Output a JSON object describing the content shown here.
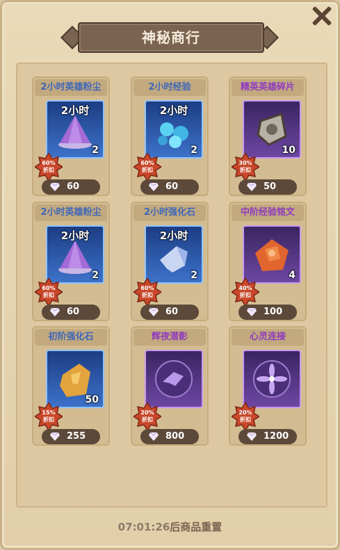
{
  "title": "神秘商行",
  "items": [
    {
      "name": "2小时英雄粉尘",
      "hour": "2小时",
      "qty": "2",
      "discount": "60%",
      "discount_label": "折扣",
      "price": "60",
      "theme": "blue",
      "art": "cone-purple",
      "name_color": "#3f66b8"
    },
    {
      "name": "2小时经验",
      "hour": "2小时",
      "qty": "2",
      "discount": "60%",
      "discount_label": "折扣",
      "price": "60",
      "theme": "blue",
      "art": "gems-teal",
      "name_color": "#3f66b8"
    },
    {
      "name": "精英英雄碎片",
      "hour": "",
      "qty": "10",
      "discount": "30%",
      "discount_label": "折扣",
      "price": "50",
      "theme": "purple",
      "art": "shard",
      "name_color": "#8e3bc0"
    },
    {
      "name": "2小时英雄粉尘",
      "hour": "2小时",
      "qty": "2",
      "discount": "60%",
      "discount_label": "折扣",
      "price": "60",
      "theme": "blue",
      "art": "cone-purple",
      "name_color": "#3f66b8"
    },
    {
      "name": "2小时强化石",
      "hour": "2小时",
      "qty": "2",
      "discount": "60%",
      "discount_label": "折扣",
      "price": "60",
      "theme": "blue",
      "art": "crystal",
      "name_color": "#3f66b8"
    },
    {
      "name": "中阶经验铭文",
      "hour": "",
      "qty": "4",
      "discount": "40%",
      "discount_label": "折扣",
      "price": "100",
      "theme": "purple",
      "art": "amber",
      "name_color": "#8e3bc0"
    },
    {
      "name": "初阶强化石",
      "hour": "",
      "qty": "50",
      "discount": "15%",
      "discount_label": "折扣",
      "price": "255",
      "theme": "blue",
      "art": "gold-stone",
      "name_color": "#3f66b8"
    },
    {
      "name": "辉夜潜影",
      "hour": "",
      "qty": "",
      "discount": "20%",
      "discount_label": "折扣",
      "price": "800",
      "theme": "purple",
      "art": "emblem-wave",
      "name_color": "#8e3bc0"
    },
    {
      "name": "心灵连接",
      "hour": "",
      "qty": "",
      "discount": "20%",
      "discount_label": "折扣",
      "price": "1200",
      "theme": "purple",
      "art": "emblem-flower",
      "name_color": "#8e3bc0"
    }
  ],
  "footer": {
    "timer": "07:01:26",
    "suffix": "后商品重置"
  },
  "colors": {
    "bg": "#e2cfa9",
    "panel": "#ddc8a1",
    "price_bar": "#5c4939",
    "badge": "#c9472a"
  }
}
